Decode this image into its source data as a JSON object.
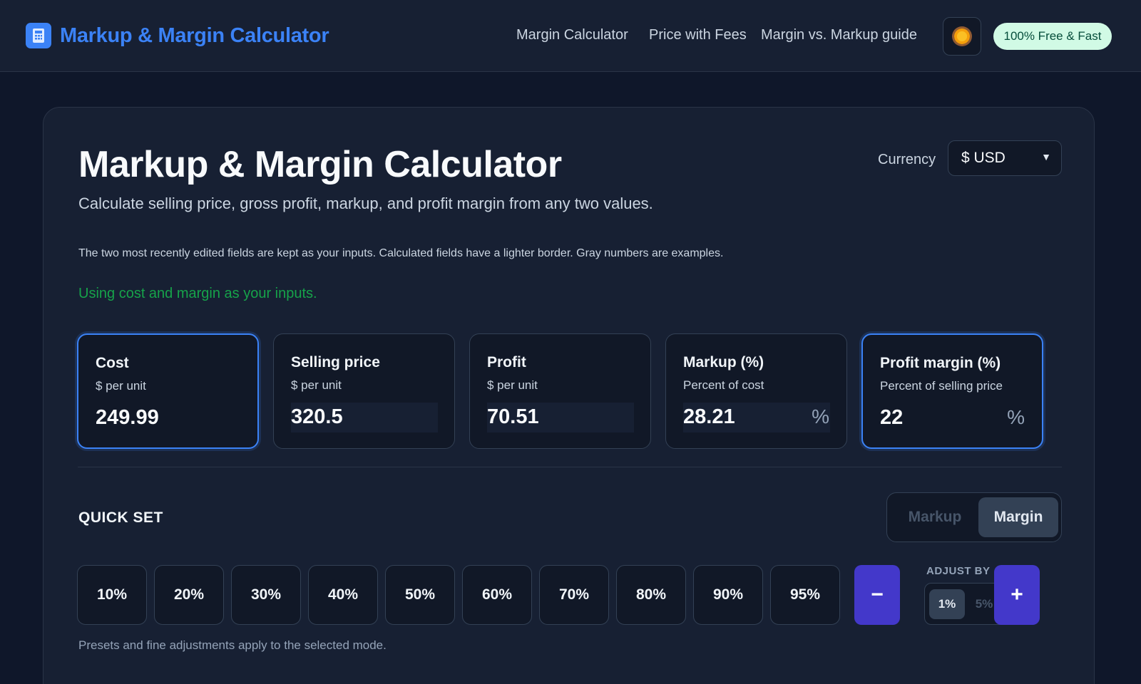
{
  "header": {
    "brand": "Markup & Margin Calculator",
    "nav": [
      "Margin Calculator",
      "Price with Fees",
      "Margin vs. Markup guide"
    ],
    "badge": "100% Free & Fast"
  },
  "main": {
    "title": "Markup & Margin Calculator",
    "subtitle": "Calculate selling price, gross profit, markup, and profit margin from any two values.",
    "currency_label": "Currency",
    "currency_value": "$ USD",
    "hint": "The two most recently edited fields are kept as your inputs. Calculated fields have a lighter border. Gray numbers are examples.",
    "status": "Using cost and margin as your inputs.",
    "fields": [
      {
        "label": "Cost",
        "sub": "$ per unit",
        "value": "249.99"
      },
      {
        "label": "Selling price",
        "sub": "$ per unit",
        "value": "320.5"
      },
      {
        "label": "Profit",
        "sub": "$ per unit",
        "value": "70.51"
      },
      {
        "label": "Markup (%)",
        "sub": "Percent of cost",
        "value": "28.21",
        "suffix": "%"
      },
      {
        "label": "Profit margin (%)",
        "sub": "Percent of selling price",
        "value": "22",
        "suffix": "%"
      }
    ]
  },
  "quick_set": {
    "title": "QUICK SET",
    "modes": [
      "Markup",
      "Margin"
    ],
    "selected_mode": "Margin",
    "presets": [
      "10%",
      "20%",
      "30%",
      "40%",
      "50%",
      "60%",
      "70%",
      "80%",
      "90%",
      "95%"
    ],
    "minus": "−",
    "plus": "+",
    "adjust_label": "ADJUST BY",
    "adjust_options": [
      "1%",
      "5%"
    ],
    "selected_adjust": "1%",
    "footnote": "Presets and fine adjustments apply to the selected mode."
  },
  "icons": {
    "brand": "calculator-icon",
    "theme": "sun-icon",
    "currency_dropdown": "chevron-down-icon"
  },
  "colors": {
    "accent": "#3b82f6",
    "status": "#16a34a",
    "button": "#4338ca",
    "badge_bg": "#d1fae5"
  }
}
